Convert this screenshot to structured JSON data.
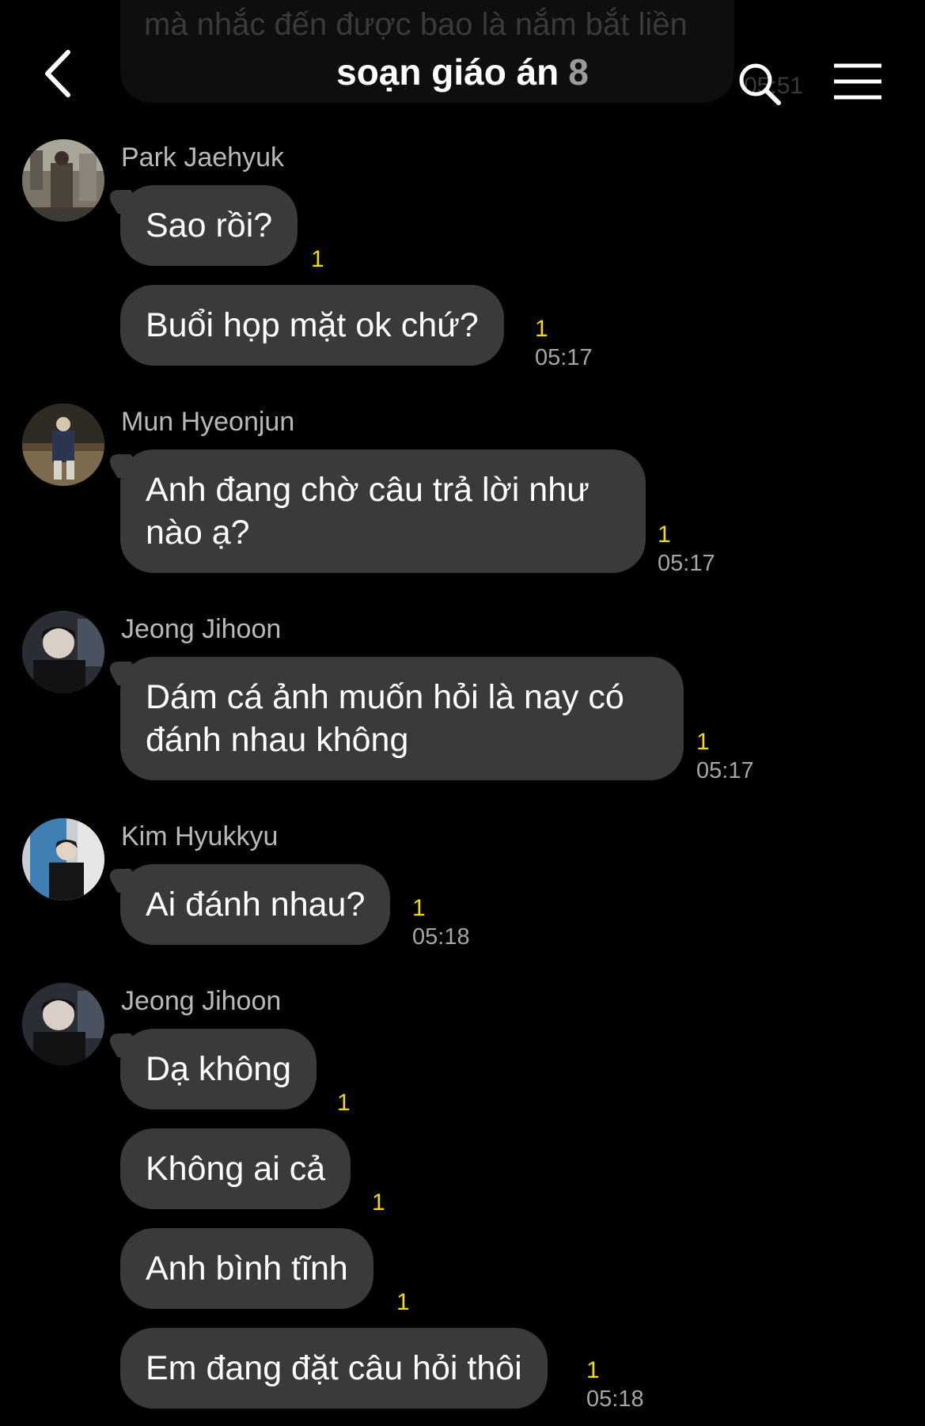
{
  "background": "#000000",
  "header": {
    "title": "soạn giáo án",
    "member_count": "8",
    "back_icon": "chevron-left-icon",
    "search_icon": "search-icon",
    "menu_icon": "menu-icon"
  },
  "ghost_message": {
    "text": "mà nhắc đến được bao là nắm bắt liền",
    "time": "05:51"
  },
  "accent_colors": {
    "unread": "#f5d90a",
    "bubble": "#3a3a3c",
    "timestamp": "#a6a6a6"
  },
  "groups": [
    {
      "sender": "Park Jaehyuk",
      "messages": [
        {
          "text": "Sao rồi?",
          "unread": "1",
          "time": ""
        },
        {
          "text": "Buổi họp mặt ok chứ?",
          "unread": "1",
          "time": "05:17"
        }
      ]
    },
    {
      "sender": "Mun Hyeonjun",
      "messages": [
        {
          "text": "Anh đang chờ câu trả lời như nào ạ?",
          "unread": "1",
          "time": "05:17"
        }
      ]
    },
    {
      "sender": "Jeong Jihoon",
      "messages": [
        {
          "text": "Dám cá ảnh muốn hỏi là nay có đánh nhau không",
          "unread": "1",
          "time": "05:17"
        }
      ]
    },
    {
      "sender": "Kim Hyukkyu",
      "messages": [
        {
          "text": "Ai đánh nhau?",
          "unread": "1",
          "time": "05:18"
        }
      ]
    },
    {
      "sender": "Jeong Jihoon",
      "messages": [
        {
          "text": "Dạ không",
          "unread": "1",
          "time": ""
        },
        {
          "text": "Không ai cả",
          "unread": "1",
          "time": ""
        },
        {
          "text": "Anh bình tĩnh",
          "unread": "1",
          "time": ""
        },
        {
          "text": "Em đang đặt câu hỏi thôi",
          "unread": "1",
          "time": "05:18"
        }
      ]
    }
  ]
}
